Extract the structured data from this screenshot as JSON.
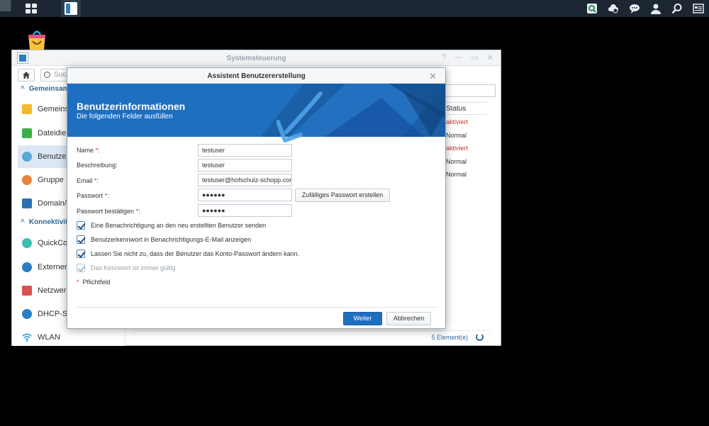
{
  "taskbar": {
    "icons": [
      "main-menu-icon",
      "control-panel-app-icon",
      "search-app-icon",
      "cloud-icon",
      "chat-icon",
      "user-icon",
      "search-icon",
      "widgets-icon"
    ]
  },
  "control_panel": {
    "title": "Systemsteuerung",
    "window_buttons": [
      "?",
      "—",
      "▭",
      "✕"
    ],
    "search_placeholder": "Such",
    "sections": [
      {
        "label": "Gemeinsam"
      },
      {
        "label": "Konnektivit"
      }
    ],
    "sidebar_items": [
      {
        "label": "Gemeinsa",
        "icon": "shared-folder-icon"
      },
      {
        "label": "Dateidien",
        "icon": "file-services-icon"
      },
      {
        "label": "Benutzer",
        "icon": "user-icon",
        "active": true
      },
      {
        "label": "Gruppe",
        "icon": "group-icon"
      },
      {
        "label": "Domain/L",
        "icon": "domain-icon"
      },
      {
        "label": "QuickCon",
        "icon": "quickconnect-icon"
      },
      {
        "label": "Externer Z",
        "icon": "external-access-icon"
      },
      {
        "label": "Netzwerk",
        "icon": "network-icon"
      },
      {
        "label": "DHCP-Ser",
        "icon": "dhcp-server-icon"
      },
      {
        "label": "WLAN",
        "icon": "wifi-icon"
      }
    ],
    "table": {
      "status_header": "Status",
      "statuses": [
        {
          "text": "aktiviert",
          "color": "#c0392b"
        },
        {
          "text": "Normal",
          "color": "#333333"
        },
        {
          "text": "aktiviert",
          "color": "#c0392b"
        },
        {
          "text": "Normal",
          "color": "#333333"
        },
        {
          "text": "Normal",
          "color": "#333333"
        }
      ]
    },
    "footer_count": "5 Element(e)"
  },
  "dialog": {
    "title": "Assistent Benutzererstellung",
    "banner_title": "Benutzerinformationen",
    "banner_subtitle": "Die folgenden Felder ausfüllen",
    "fields": {
      "name": {
        "label": "Name",
        "required": "*",
        "value": "testuser"
      },
      "description": {
        "label": "Beschreibung:",
        "value": "testuser"
      },
      "email": {
        "label": "Email",
        "required": "*",
        "value": "testuser@hofschulz-schopp.com"
      },
      "password": {
        "label": "Passwort",
        "required": "*",
        "value": "●●●●●●"
      },
      "password_confirm": {
        "label": "Passwort bestätigen",
        "required": "*",
        "value": "●●●●●●"
      }
    },
    "random_password_button": "Zufälliges Passwort erstellen",
    "checkboxes": [
      {
        "label": "Eine Benachrichtigung an den neu erstellten Benutzer senden",
        "checked": true,
        "disabled": false
      },
      {
        "label": "Benutzerkennwort in Benachrichtigungs-E-Mail anzeigen",
        "checked": true,
        "disabled": false
      },
      {
        "label": "Lassen Sie nicht zu, dass der Benutzer das Konto-Passwort ändern kann.",
        "checked": true,
        "disabled": false
      },
      {
        "label": "Das Kennwort ist immer gültig",
        "checked": true,
        "disabled": true
      }
    ],
    "required_note_star": "*",
    "required_note": "Pflichtfeld",
    "next_button": "Weiter",
    "cancel_button": "Abbrechen"
  },
  "colors": {
    "accent": "#1f6fc0",
    "taskbar": "#1c2733",
    "error": "#c0392b"
  }
}
